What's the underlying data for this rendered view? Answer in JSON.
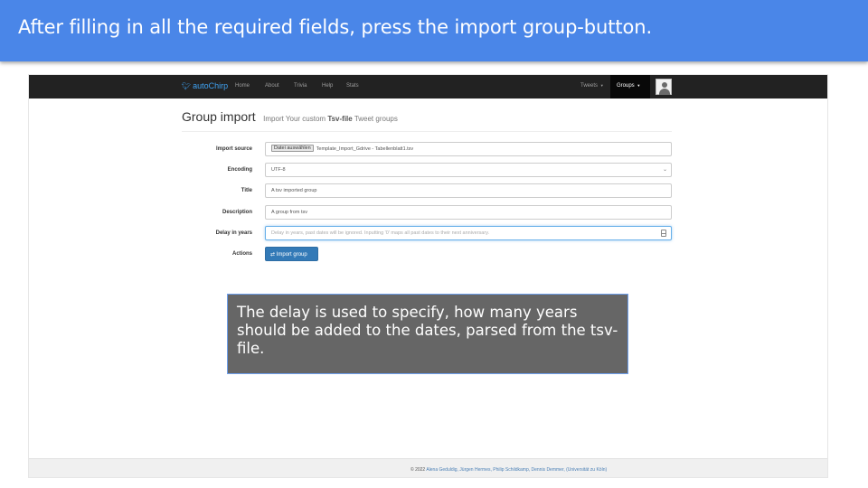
{
  "slide": {
    "title": "After filling in all the required fields, press the import group-button."
  },
  "navbar": {
    "brand": "autoChirp",
    "links": [
      "Home",
      "About",
      "Trivia",
      "Help",
      "Stats"
    ],
    "tweets_label": "Tweets",
    "groups_label": "Groups"
  },
  "page": {
    "heading": "Group import",
    "subheading_prefix": "Import Your custom",
    "subheading_bold": "Tsv-file",
    "subheading_suffix": "Tweet groups"
  },
  "form": {
    "import_source": {
      "label": "Import source",
      "button": "Datei auswählen",
      "filename": "Template_Import_Gdrive - Tabellenblatt1.tsv"
    },
    "encoding": {
      "label": "Encoding",
      "value": "UTF-8"
    },
    "title": {
      "label": "Title",
      "value": "A tsv imported group"
    },
    "description": {
      "label": "Description",
      "value": "A group from tsv"
    },
    "delay": {
      "label": "Delay in years",
      "placeholder": "Delay in years, past dates will be ignored. Inputting '0' maps all past dates to their next anniversary."
    },
    "actions": {
      "label": "Actions",
      "button": "Import group"
    }
  },
  "footer": {
    "copyright": "© 2022",
    "authors": "Alena Geduldig, Jürgen Hermes, Philip Schildkamp, Dennis Demmer, (Universität zu Köln)"
  },
  "callout": {
    "text": "The delay is used to specify, how many years should be added to the dates, parsed from the tsv-file."
  },
  "colors": {
    "header_blue": "#4a86e8",
    "navbar": "#222222",
    "brand": "#3fa2f2",
    "primary_button": "#337ab7",
    "callout_bg": "#666666"
  },
  "icons": {
    "brand": "twitter-bird-icon",
    "button": "exchange-arrows-icon",
    "select": "chevron-down-icon",
    "spinner": "number-spinner-icon",
    "avatar": "user-avatar-icon"
  }
}
